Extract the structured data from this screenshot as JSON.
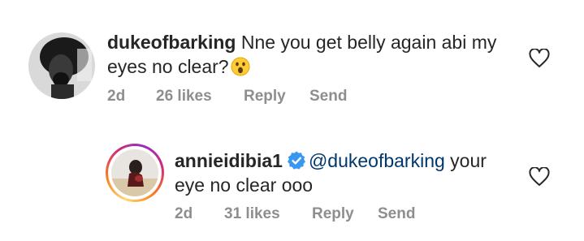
{
  "comments": [
    {
      "username": "dukeofbarking",
      "text_line1": "Nne you get belly again abi my",
      "text_line2": "eyes no clear?",
      "emoji_icon": "astonished-face-emoji",
      "time": "2d",
      "likes": "26 likes",
      "reply_label": "Reply",
      "send_label": "Send",
      "verified": false
    },
    {
      "username": "annieidibia1",
      "mention": "@dukeofbarking",
      "text_after_mention": " your",
      "text_line2": "eye no clear ooo",
      "time": "2d",
      "likes": "31 likes",
      "reply_label": "Reply",
      "send_label": "Send",
      "verified": true,
      "verified_color": "#3897f0"
    }
  ],
  "colors": {
    "text": "#262626",
    "meta": "#8e8e8e",
    "mention": "#00376b"
  }
}
